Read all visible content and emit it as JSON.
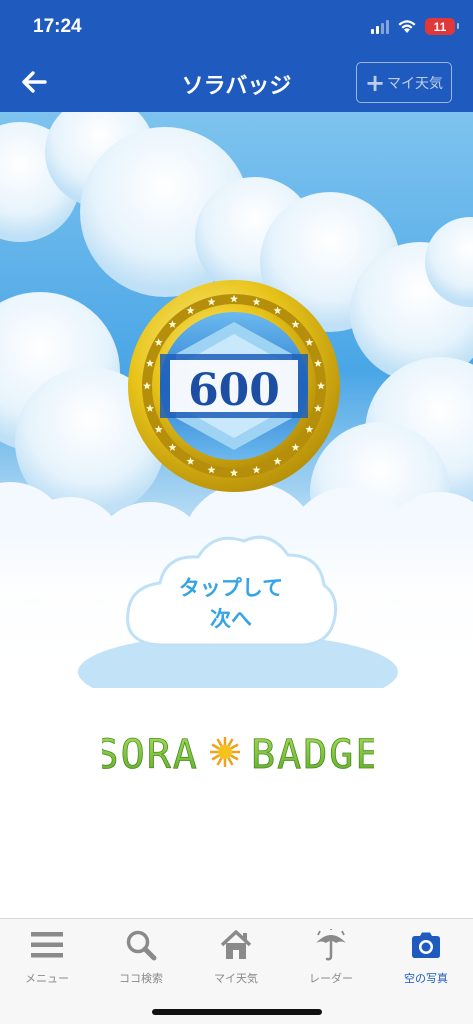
{
  "status": {
    "time": "17:24",
    "battery": "11"
  },
  "nav": {
    "title": "ソラバッジ",
    "my_weather_label": "マイ天気",
    "back_icon": "arrow-left-icon",
    "add_icon": "plus-icon"
  },
  "badge": {
    "number": "600"
  },
  "next_button": {
    "line1": "タップして",
    "line2": "次へ"
  },
  "logo": {
    "text": "SORA BADGE"
  },
  "tabs": [
    {
      "label": "メニュー",
      "icon": "menu-icon",
      "active": false
    },
    {
      "label": "ココ検索",
      "icon": "search-icon",
      "active": false
    },
    {
      "label": "マイ天気",
      "icon": "home-icon",
      "active": false
    },
    {
      "label": "レーダー",
      "icon": "umbrella-icon",
      "active": false
    },
    {
      "label": "空の写真",
      "icon": "camera-icon",
      "active": true
    }
  ],
  "colors": {
    "header": "#1f5bbf",
    "active_tab": "#1f5bbf",
    "inactive_tab": "#8a8a8a",
    "badge_gold": "#e8c41a",
    "logo_green": "#7cc13a"
  }
}
